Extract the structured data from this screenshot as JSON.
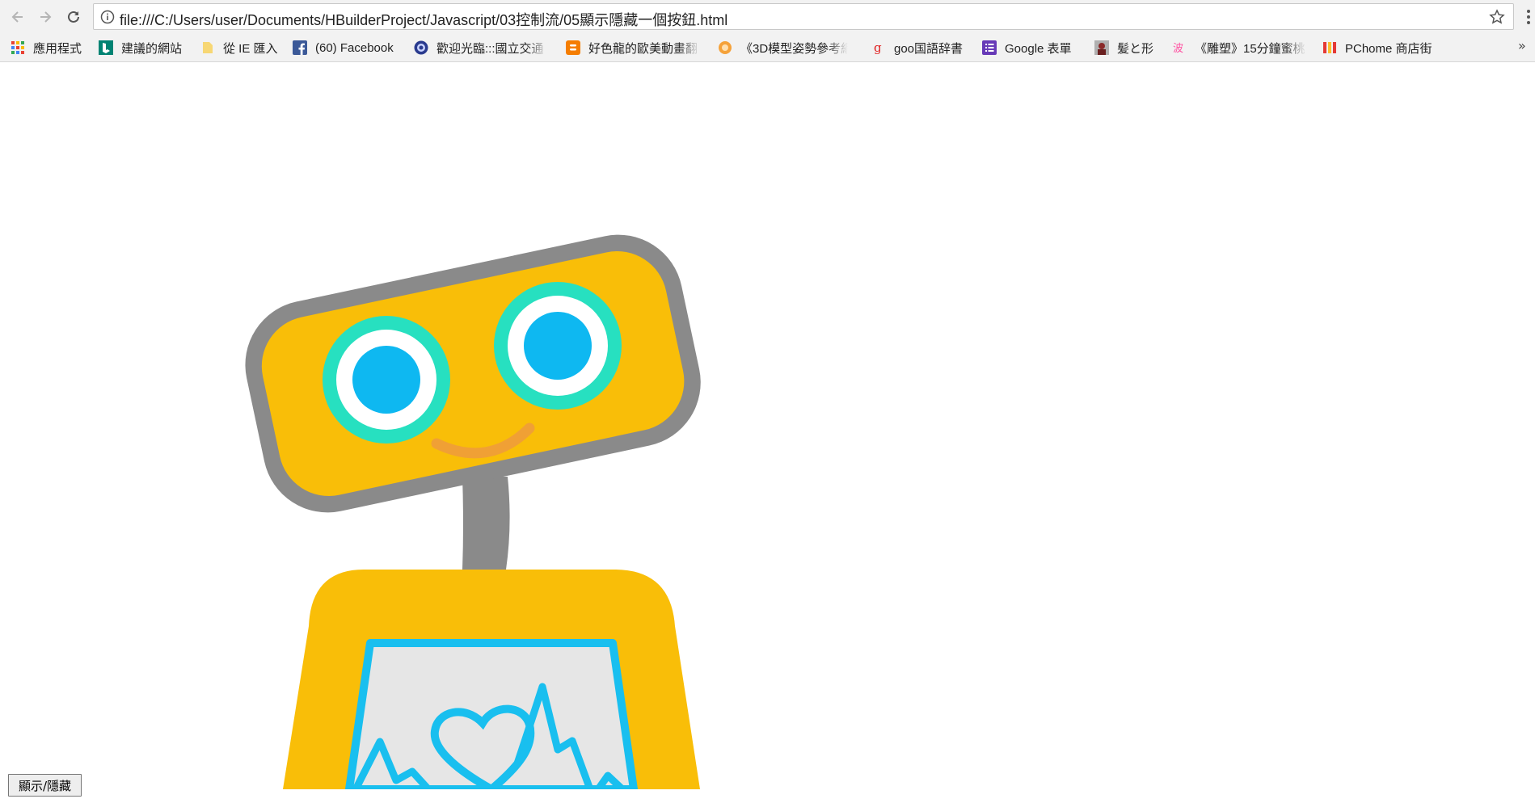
{
  "browser": {
    "url": "file:///C:/Users/user/Documents/HBuilderProject/Javascript/03控制流/05顯示隱藏一個按鈕.html",
    "icons": {
      "back": "back-arrow-icon",
      "forward": "forward-arrow-icon",
      "reload": "reload-icon",
      "info": "info-icon",
      "star": "star-icon",
      "menu": "kebab-menu-icon"
    }
  },
  "bookmarks": [
    {
      "label": "應用程式",
      "icon": "apps-grid-icon"
    },
    {
      "label": "建議的網站",
      "icon": "bing-icon"
    },
    {
      "label": "從 IE 匯入",
      "icon": "folder-icon"
    },
    {
      "label": "(60) Facebook",
      "icon": "facebook-icon"
    },
    {
      "label": "歡迎光臨:::國立交通",
      "icon": "nctu-icon"
    },
    {
      "label": "好色龍的歐美動畫翻",
      "icon": "blogger-icon"
    },
    {
      "label": "《3D模型姿勢參考網",
      "icon": "orange-circle-icon"
    },
    {
      "label": "goo国語辞書",
      "icon": "goo-icon"
    },
    {
      "label": "Google 表單",
      "icon": "google-forms-icon"
    },
    {
      "label": "髪と形",
      "icon": "portrait-icon"
    },
    {
      "label": "《雕塑》15分鐘蜜桃",
      "icon": "pink-wave-icon"
    },
    {
      "label": "PChome 商店街",
      "icon": "pchome-icon"
    }
  ],
  "bookmarks_overflow": "»",
  "page": {
    "image": "robot-illustration",
    "toggle_button_label": "顯示/隱藏"
  },
  "colors": {
    "robot_yellow": "#F9BE08",
    "robot_gray": "#8A8A8A",
    "eye_ring": "#27E0C0",
    "pupil_blue": "#0EB8F1",
    "screen_blue": "#19BFEF",
    "smile_orange": "#F0A035"
  }
}
